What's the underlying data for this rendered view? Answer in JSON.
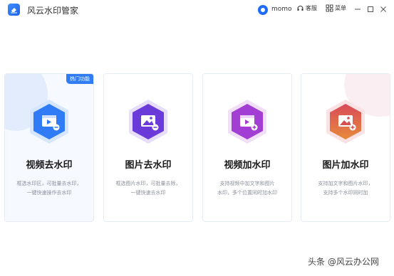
{
  "app": {
    "title": "风云水印管家",
    "logo_icon": "eraser-icon"
  },
  "titlebar": {
    "user_name": "momo",
    "service_label": "客服",
    "menu_label": "菜单"
  },
  "cards": [
    {
      "title": "视频去水印",
      "desc_line1": "视频去水印",
      "desc": [
        "框选水印区，可批量去水印，",
        "一键快速操作去水印"
      ],
      "badge": "热门功能",
      "accent": "#2f7cf6",
      "icon": "video-remove-icon"
    },
    {
      "title": "图片去水印",
      "desc": [
        "框选图片水印，可批量去除，",
        "一键快速去水印"
      ],
      "accent": "#6a3bd8",
      "icon": "image-remove-icon"
    },
    {
      "title": "视频加水印",
      "desc": [
        "支持视频中加文字和图片",
        "水印，多个位置同时加水印"
      ],
      "accent": "#a23ed3",
      "icon": "video-add-icon"
    },
    {
      "title": "图片加水印",
      "desc": [
        "支持加文字和图片水印，",
        "支持多个水印同时加"
      ],
      "accent": "#d4504f",
      "icon": "image-add-icon"
    }
  ],
  "watermark": "头条 @风云办公网"
}
